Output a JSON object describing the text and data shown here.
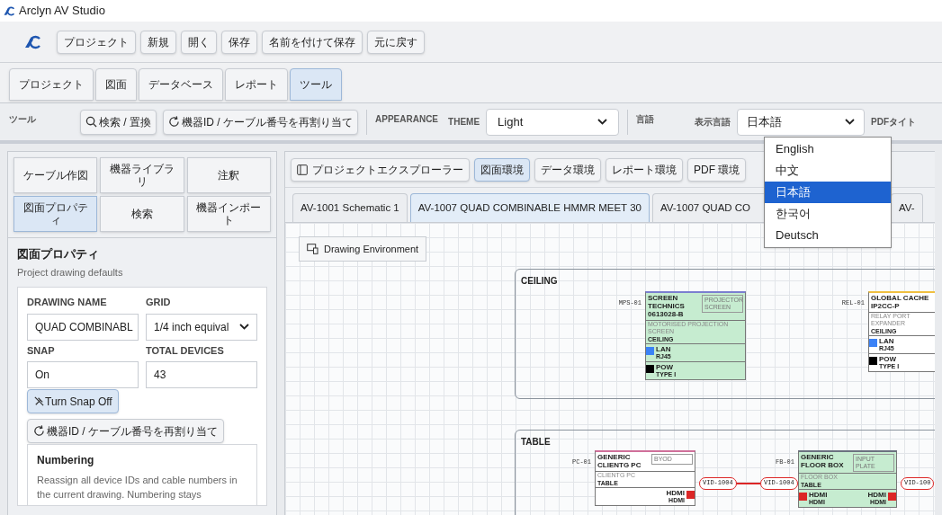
{
  "window": {
    "title": "Arclyn AV Studio"
  },
  "toolbar": {
    "buttons": [
      "プロジェクト",
      "新規",
      "開く",
      "保存",
      "名前を付けて保存",
      "元に戻す"
    ]
  },
  "menu_tabs": [
    {
      "label": "プロジェクト",
      "selected": false
    },
    {
      "label": "図面",
      "selected": false
    },
    {
      "label": "データベース",
      "selected": false
    },
    {
      "label": "レポート",
      "selected": false
    },
    {
      "label": "ツール",
      "selected": true
    }
  ],
  "ribbon": {
    "group_label": "ツール",
    "search_button": "検索 / 置換",
    "renumber_button": "機器ID / ケーブル番号を再割り当て",
    "appearance_label": "APPEARANCE",
    "theme_label": "THEME",
    "theme_value": "Light",
    "language_label": "言語",
    "display_language_label": "表示言語",
    "display_language_value": "日本語",
    "pdf_label": "PDFタイト"
  },
  "language_dropdown": {
    "expanded": true,
    "options": [
      {
        "label": "English",
        "selected": false
      },
      {
        "label": "中文",
        "selected": false
      },
      {
        "label": "日本語",
        "selected": true
      },
      {
        "label": "한국어",
        "selected": false
      },
      {
        "label": "Deutsch",
        "selected": false
      }
    ]
  },
  "left_panel": {
    "tools": [
      {
        "label": "ケーブル作図",
        "selected": false
      },
      {
        "label": "機器ライブラリ",
        "selected": false
      },
      {
        "label": "注釈",
        "selected": false
      },
      {
        "label": "図面プロパティ",
        "selected": true
      },
      {
        "label": "検索",
        "selected": false
      },
      {
        "label": "機器インポート",
        "selected": false
      }
    ],
    "section_title": "図面プロパティ",
    "section_subtitle": "Project drawing defaults",
    "fields": [
      {
        "label": "DRAWING NAME",
        "value": "QUAD COMBINABL",
        "kind": "text"
      },
      {
        "label": "GRID",
        "value": "1/4 inch equival",
        "kind": "select"
      },
      {
        "label": "SNAP",
        "value": "On",
        "kind": "text"
      },
      {
        "label": "TOTAL DEVICES",
        "value": "43",
        "kind": "text"
      }
    ],
    "snap_button": {
      "label": "Turn Snap Off",
      "selected": true
    },
    "renumber_button": "機器ID / ケーブル番号を再割り当て",
    "numbering": {
      "title": "Numbering",
      "text": "Reassign all device IDs and cable numbers in the current drawing. Numbering stays"
    }
  },
  "workspace": {
    "environments": [
      {
        "label": "プロジェクトエクスプローラー",
        "selected": false
      },
      {
        "label": "図面環境",
        "selected": true
      },
      {
        "label": "データ環境",
        "selected": false
      },
      {
        "label": "レポート環境",
        "selected": false
      },
      {
        "label": "PDF 環境",
        "selected": false
      }
    ],
    "drawing_tabs": [
      {
        "label": "AV-1001 Schematic 1",
        "selected": false
      },
      {
        "label": "AV-1007 QUAD COMBINABLE HMMR MEET 30",
        "selected": true
      },
      {
        "label": "AV-1007 QUAD CO",
        "selected": false
      },
      {
        "label": "AV-",
        "selected": false
      }
    ],
    "canvas": {
      "environment_button": "Drawing Environment",
      "groups": [
        {
          "label": "CEILING"
        },
        {
          "label": "TABLE"
        }
      ],
      "devices": [
        {
          "tag": "MPS-01",
          "make": "SCREEN TECHNICS",
          "model": "0613028-B",
          "description": "MOTORISED PROJECTION SCREEN",
          "location": "CEILING",
          "badge": "PROJECTOR SCREEN",
          "color": "#7b7fd0",
          "shaded": true,
          "port_rows": [
            {
              "left": {
                "name": "LAN",
                "type": "RJ45",
                "color": "#3b82f6"
              }
            },
            {
              "left": {
                "name": "POW",
                "type": "TYPE I",
                "color": "#000000"
              }
            }
          ]
        },
        {
          "tag": "REL-01",
          "make": "GLOBAL CACHE",
          "model": "IP2CC-P",
          "description": "RELAY PORT EXPANDER",
          "location": "CEILING",
          "color": "#f0c040",
          "shaded": false,
          "port_rows": [
            {
              "left": {
                "name": "LAN",
                "type": "RJ45",
                "color": "#3b82f6"
              }
            },
            {
              "left": {
                "name": "POW",
                "type": "TYPE I",
                "color": "#000000"
              }
            }
          ]
        },
        {
          "tag": "PC-01",
          "make": "GENERIC",
          "model": "CLIENTG PC",
          "description": "CLIENTG PC",
          "location": "TABLE",
          "badge": "BYOD",
          "color": "#d0709a",
          "shaded": false,
          "port_rows": [
            {
              "right": {
                "name": "HDMI",
                "type": "HDMI",
                "color": "#dc2626"
              }
            }
          ]
        },
        {
          "tag": "FB-01",
          "make": "GENERIC",
          "model": "FLOOR BOX",
          "description": "FLOOR BOX",
          "location": "TABLE",
          "badge": "INPUT PLATE",
          "color": "#6b7280",
          "shaded": true,
          "port_rows": [
            {
              "left": {
                "name": "HDMI",
                "type": "HDMI",
                "color": "#dc2626"
              },
              "right": {
                "name": "HDMI",
                "type": "HDMI",
                "color": "#dc2626"
              }
            }
          ]
        }
      ],
      "cables": [
        {
          "labels": [
            "VID-1004",
            "VID-1004"
          ],
          "color": "#dc2626"
        },
        {
          "labels": [
            "VID-100"
          ],
          "color": "#dc2626"
        }
      ]
    }
  }
}
